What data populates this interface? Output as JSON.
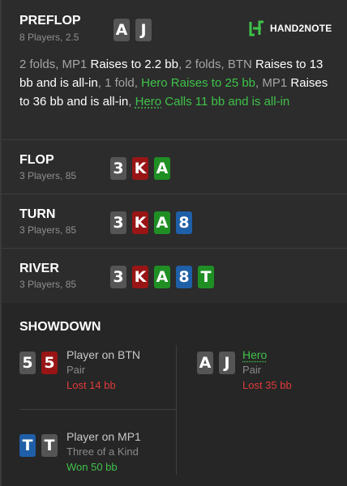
{
  "preflop": {
    "title": "PREFLOP",
    "sub": "8 Players, 2.5",
    "hero_cards": [
      {
        "rank": "A",
        "suit": "x"
      },
      {
        "rank": "J",
        "suit": "x"
      }
    ],
    "actions": [
      {
        "text": "2 folds, MP1 ",
        "style": "gray"
      },
      {
        "text": "Raises to 2.2 bb",
        "style": "white"
      },
      {
        "text": ", 2 folds, BTN ",
        "style": "gray"
      },
      {
        "text": "Raises to 13 bb and is all-in",
        "style": "white"
      },
      {
        "text": ", 1 fold, ",
        "style": "gray"
      },
      {
        "text": "Hero",
        "style": "green"
      },
      {
        "text": " Raises to 25 bb",
        "style": "green"
      },
      {
        "text": ", MP1 ",
        "style": "gray"
      },
      {
        "text": "Raises to 36 bb and is all-in",
        "style": "white"
      },
      {
        "text": ", ",
        "style": "gray"
      },
      {
        "text": "Hero",
        "style": "hero"
      },
      {
        "text": " Calls 11 bb and is all-in",
        "style": "green"
      }
    ]
  },
  "logo": {
    "text": "HAND2NOTE",
    "color": "#3fc24a"
  },
  "flop": {
    "title": "FLOP",
    "sub": "3 Players, 85",
    "cards": [
      {
        "rank": "3",
        "suit": "x"
      },
      {
        "rank": "K",
        "suit": "h"
      },
      {
        "rank": "A",
        "suit": "c"
      }
    ]
  },
  "turn": {
    "title": "TURN",
    "sub": "3 Players, 85",
    "cards": [
      {
        "rank": "3",
        "suit": "x"
      },
      {
        "rank": "K",
        "suit": "h"
      },
      {
        "rank": "A",
        "suit": "c"
      },
      {
        "rank": "8",
        "suit": "d"
      }
    ]
  },
  "river": {
    "title": "RIVER",
    "sub": "3 Players, 85",
    "cards": [
      {
        "rank": "3",
        "suit": "x"
      },
      {
        "rank": "K",
        "suit": "h"
      },
      {
        "rank": "A",
        "suit": "c"
      },
      {
        "rank": "8",
        "suit": "d"
      },
      {
        "rank": "T",
        "suit": "c"
      }
    ]
  },
  "showdown": {
    "title": "SHOWDOWN",
    "players": [
      {
        "name": "Player on BTN",
        "desc": "Pair",
        "result": "Lost 14 bb",
        "outcome": "lost",
        "cards": [
          {
            "rank": "5",
            "suit": "x"
          },
          {
            "rank": "5",
            "suit": "h"
          }
        ]
      },
      {
        "name": "Hero",
        "desc": "Pair",
        "result": "Lost 35 bb",
        "outcome": "lost",
        "cards": [
          {
            "rank": "A",
            "suit": "x"
          },
          {
            "rank": "J",
            "suit": "x"
          }
        ]
      },
      {
        "name": "Player on MP1",
        "desc": "Three of a Kind",
        "result": "Won 50 bb",
        "outcome": "won",
        "cards": [
          {
            "rank": "T",
            "suit": "d"
          },
          {
            "rank": "T",
            "suit": "x"
          }
        ]
      }
    ]
  }
}
